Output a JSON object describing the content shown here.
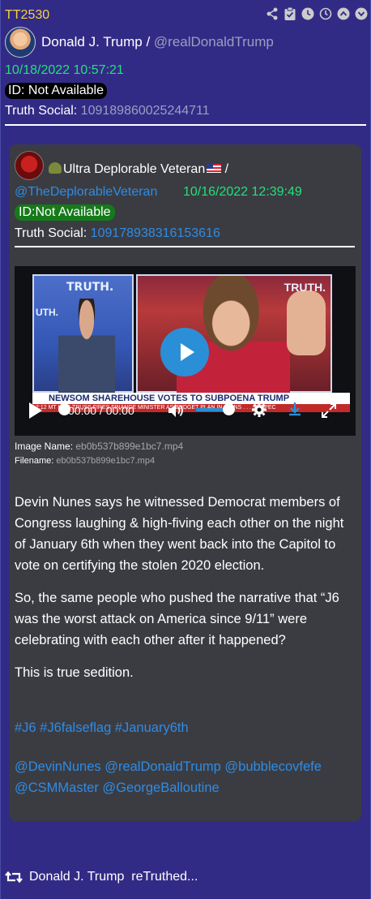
{
  "post": {
    "code": "TT2530",
    "author_name": "Donald J. Trump",
    "separator": " / ",
    "author_handle": "@realDonaldTrump",
    "datetime": "10/18/2022 10:57:21",
    "id_label": "ID: Not Available",
    "truth_social_label": "Truth Social:",
    "truth_social_id": "109189860025244711",
    "header_icons": [
      "share-icon",
      "clipboard-check-icon",
      "clock-icon",
      "history-icon",
      "chevron-up-icon",
      "chevron-down-icon"
    ]
  },
  "quoted": {
    "author_name": "Ultra Deplorable Veteran",
    "separator": " /",
    "handle": "@TheDeplorableVeteran",
    "datetime": "10/16/2022 12:39:49",
    "id_label": "ID:Not Available",
    "truth_social_label": "Truth Social:",
    "truth_social_id": "109178938316153616",
    "video": {
      "brand_text": "TRUTH.",
      "brand_text_2": "UTH.",
      "brand_text_3": "TRUTH.",
      "headline": "NEWSOM SHAREHOUSE VOTES TO SUBPOENA TRUMP",
      "ticker": "2:12 MT   UK'S TRUSS FIRES FINANCE MINISTER AS BUDGET PLAN IN RUINS . . .   SUSPEC",
      "time_current": "00:00",
      "time_sep": " / ",
      "time_total": "00:00",
      "volume_level": 0.7
    },
    "image_name_label": "Image Name:",
    "image_name": "eb0b537b899e1bc7.mp4",
    "filename_label": "Filename:",
    "filename": "eb0b537b899e1bc7.mp4",
    "paragraphs": [
      "Devin Nunes says he witnessed Democrat members of Congress laughing & high-fiving each other on the night of January 6th when they went back into the Capitol to vote on certifying the stolen 2020 election.",
      "So, the same people who pushed the narrative that “J6 was the worst attack on America since 9/11” were celebrating with each other after it happened?",
      "This is true sedition."
    ],
    "hashtags": "#J6 #J6falseflag #January6th",
    "mentions": "@DevinNunes @realDonaldTrump @bubblecovfefe @CSMMaster @GeorgeBalloutine"
  },
  "retruth": {
    "name": "Donald J. Trump",
    "action": "reTruthed..."
  },
  "colors": {
    "background": "#322b86",
    "code": "#f5d142",
    "date": "#24e07a",
    "link": "#2e8ce6",
    "muted": "#9b9fbf",
    "quote_bg": "#3b3c42",
    "id_badge_green": "#157a1a"
  }
}
